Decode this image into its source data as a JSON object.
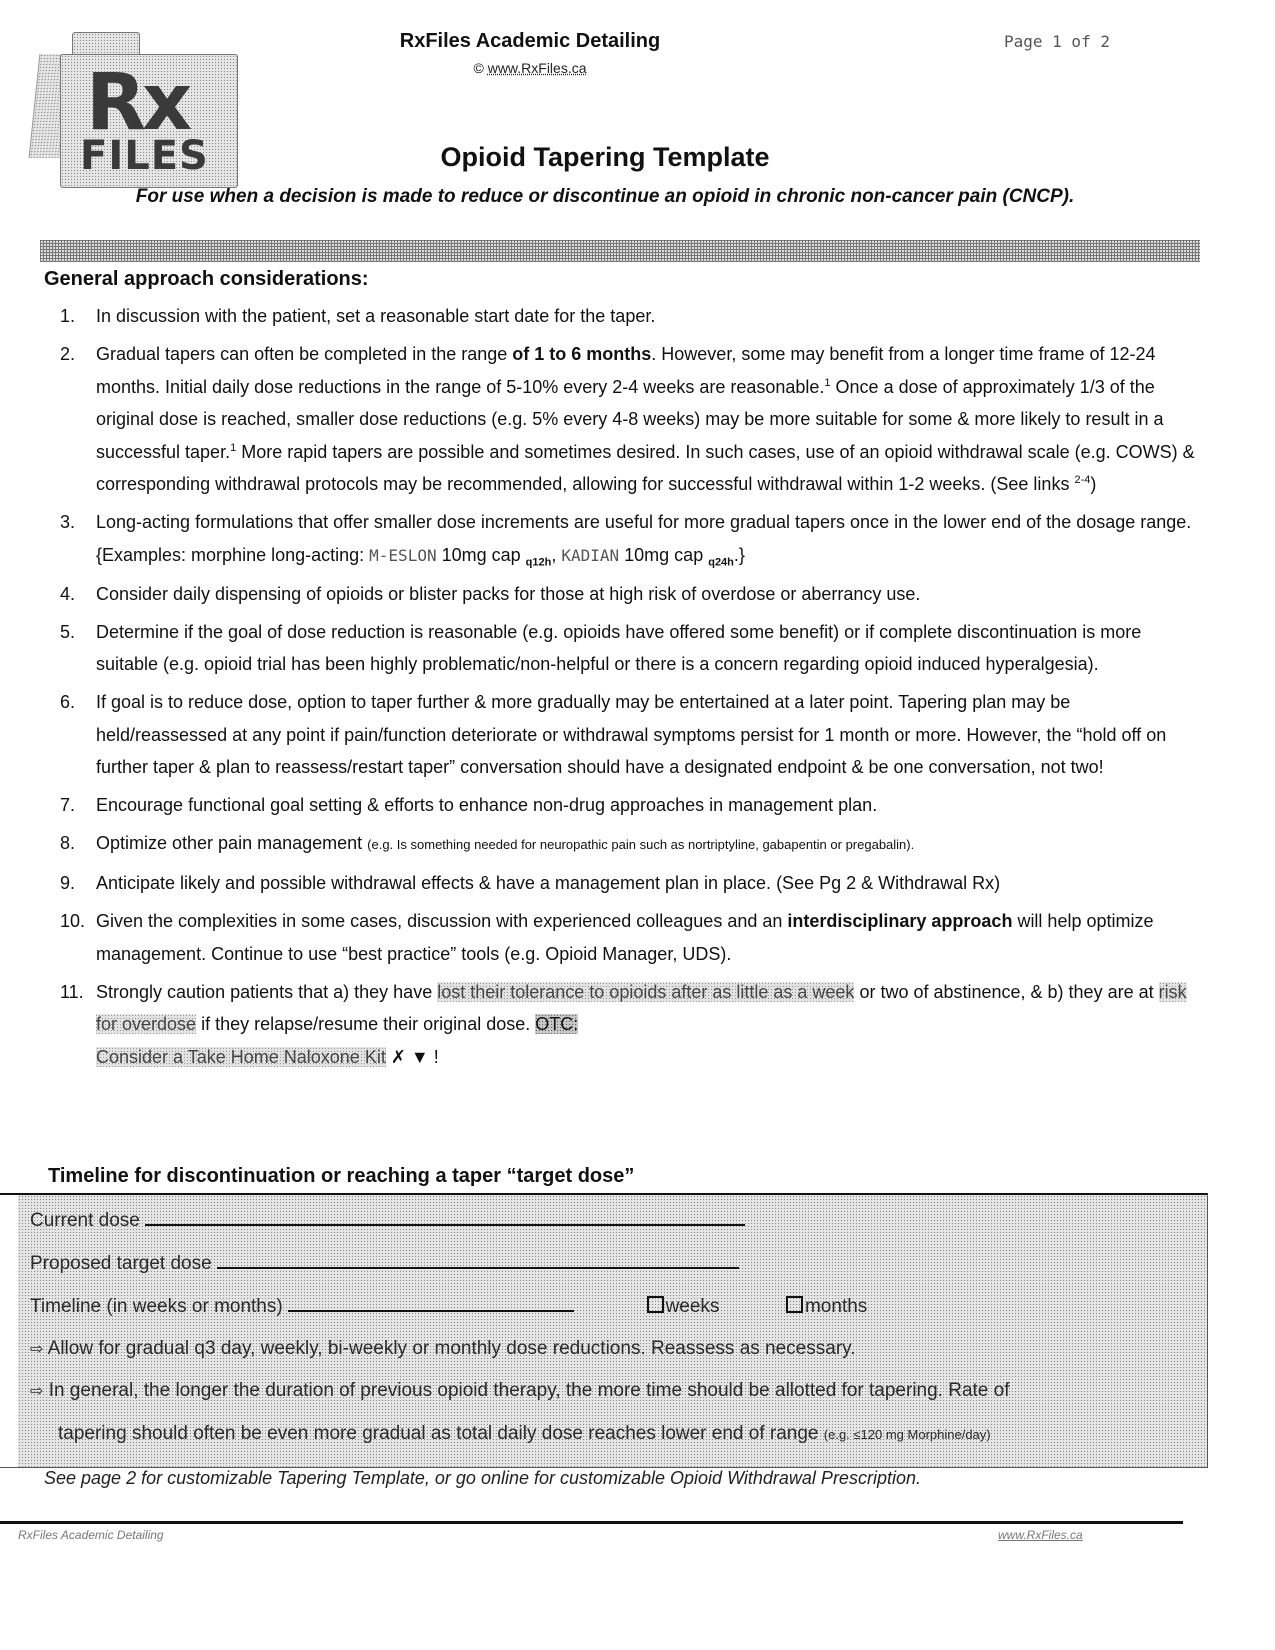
{
  "header": {
    "logo": {
      "line1": "Rx",
      "line2": "FILES"
    },
    "organization": "RxFiles Academic Detailing",
    "copyright_symbol": "©",
    "website": "www.RxFiles.ca",
    "page_indicator": "Page 1 of 2"
  },
  "document": {
    "title": "Opioid Tapering Template",
    "subtitle": "For use when a decision is made to reduce or discontinue an opioid in chronic non-cancer pain (CNCP)."
  },
  "general_approach": {
    "heading": "General approach considerations:",
    "items": [
      {
        "number": "1.",
        "text": "In discussion with the patient, set a reasonable start date for the taper."
      },
      {
        "number": "2.",
        "text_a": "Gradual tapers can often be completed in the range ",
        "bold": "of 1 to 6 months",
        "text_b": ".  However, some may benefit from a longer time frame of 12-24 months.  Initial daily dose reductions in the range of 5-10% every 2-4 weeks are reasonable.",
        "ref1": "1",
        "text_c": "  Once a dose of approximately 1/3 of the original dose is reached, smaller dose reductions (e.g. 5% every 4-8 weeks) may be more suitable for some & more likely to result in a successful taper.",
        "ref2": "1",
        "text_d": " More rapid tapers are possible and sometimes desired.  In such cases, use of an opioid withdrawal scale (e.g. COWS) & corresponding withdrawal protocols may be recommended, allowing for successful withdrawal within 1-2 weeks.  (See links ",
        "ref3": "2-4",
        "text_e": ")"
      },
      {
        "number": "3.",
        "text_a": "Long-acting formulations that offer smaller dose increments are useful for more gradual tapers once in the lower end of the dosage range. {Examples: morphine long-acting: ",
        "brand1": "M-ESLON",
        "text_b": " 10mg cap ",
        "freq1": "q12h",
        "text_c": ", ",
        "brand2": "KADIAN",
        "text_d": " 10mg cap ",
        "freq2": "q24h",
        "text_e": ".}"
      },
      {
        "number": "4.",
        "text": "Consider daily dispensing of opioids or blister packs for those at high risk of overdose or aberrancy use."
      },
      {
        "number": "5.",
        "text": "Determine if the goal of dose reduction is reasonable (e.g. opioids have offered some benefit) or if complete discontinuation is more suitable (e.g. opioid trial has been highly problematic/non-helpful or there is a concern regarding opioid induced hyperalgesia)."
      },
      {
        "number": "6.",
        "text": "If goal is to reduce dose, option to taper further & more gradually may be entertained at a later point.  Tapering plan may be held/reassessed at any point if pain/function deteriorate or withdrawal symptoms persist for 1 month or more.  However, the “hold off on further taper & plan to reassess/restart taper” conversation should have a designated endpoint & be one conversation, not two!"
      },
      {
        "number": "7.",
        "text": "Encourage functional goal setting & efforts to enhance non-drug approaches in management plan."
      },
      {
        "number": "8.",
        "text": "Optimize other pain management ",
        "small": "(e.g. Is something needed for neuropathic pain such as nortriptyline, gabapentin or pregabalin)."
      },
      {
        "number": "9.",
        "text": "Anticipate likely and possible withdrawal effects & have a management plan in place. (See Pg 2 & Withdrawal Rx)"
      },
      {
        "number": "10.",
        "text_a": "Given the complexities in some cases, discussion with experienced colleagues and an ",
        "bold": "interdisciplinary approach",
        "text_b": " will help optimize management.  Continue to use “best practice” tools (e.g. Opioid Manager, UDS)."
      },
      {
        "number": "11.",
        "text_a": "Strongly caution patients that a) they have ",
        "hl1": "lost their tolerance to opioids after as little as a week",
        "text_b": " or two of abstinence, & b) they are at ",
        "hl2": "risk for overdose",
        "text_c": " if they relapse/resume their original dose. ",
        "hl3": "OTC:",
        "hl4": "Consider a Take Home Naloxone Kit",
        "symbols": "✗ ▼",
        "tail": " !"
      }
    ]
  },
  "timeline": {
    "heading": "Timeline for discontinuation or reaching a taper “target dose”",
    "current_dose_label": "Current dose",
    "current_dose_value": "",
    "target_dose_label": "Proposed target dose",
    "target_dose_value": "",
    "timeline_label": "Timeline (in weeks or months)",
    "timeline_value": "",
    "option_weeks": "weeks",
    "option_months": "months",
    "weeks_checked": false,
    "months_checked": false,
    "arrow_symbol": "⇨",
    "note1": "Allow for gradual q3 day, weekly, bi-weekly or monthly dose reductions.  Reassess as necessary.",
    "note2_line1": "In general, the longer the duration of previous opioid therapy, the more time should be allotted for tapering.  Rate of",
    "note2_line2": "tapering should often be even more gradual as total daily dose reaches lower end of range ",
    "note2_small": "(e.g. ≤120 mg Morphine/day)"
  },
  "see_note": "See page 2 for customizable Tapering Template, or go online for customizable Opioid Withdrawal Prescription.",
  "footer": {
    "left": "RxFiles Academic Detailing",
    "right": "www.RxFiles.ca"
  }
}
